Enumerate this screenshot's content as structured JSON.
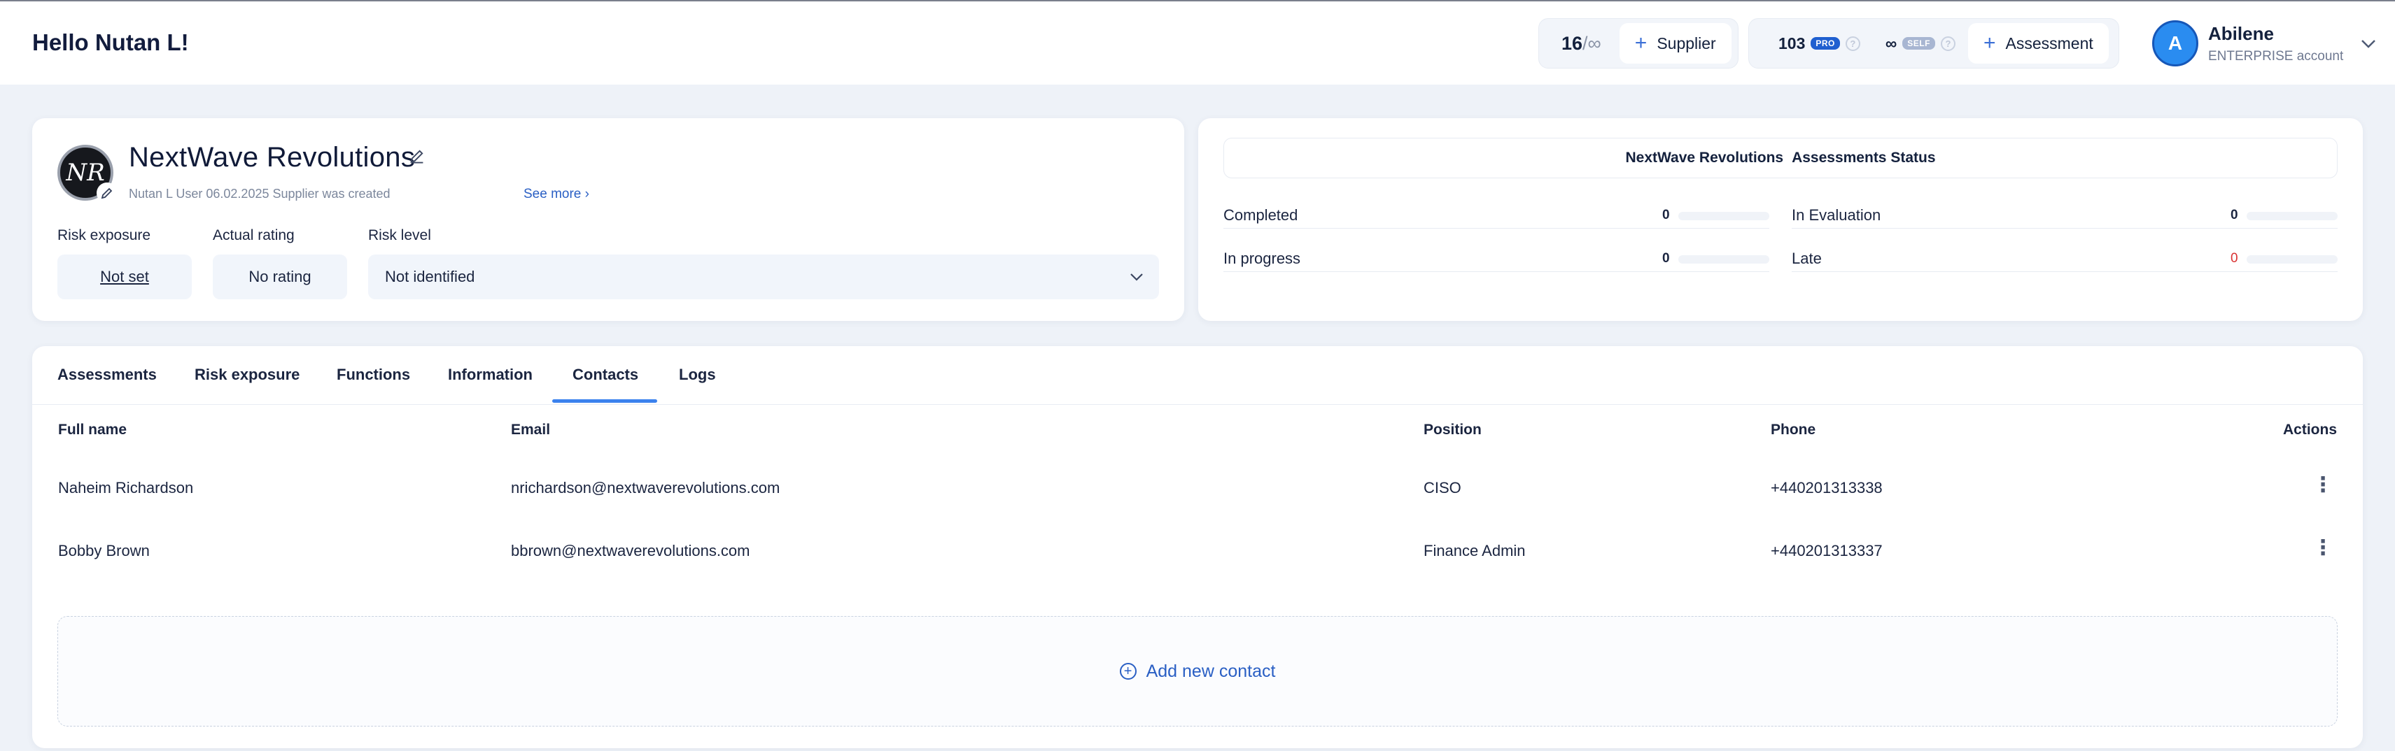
{
  "header": {
    "greeting": "Hello Nutan L!",
    "supplier_count": "16",
    "supplier_limit": "/∞",
    "supplier_button": "Supplier",
    "pro_count": "103",
    "pro_badge": "PRO",
    "self_count": "∞",
    "self_badge": "SELF",
    "assessment_button": "Assessment",
    "help_glyph": "?"
  },
  "user": {
    "initial": "A",
    "name": "Abilene",
    "plan": "ENTERPRISE account"
  },
  "company": {
    "logo_text": "NR",
    "name": "NextWave Revolutions",
    "created_note": "Nutan L User 06.02.2025 Supplier was created",
    "see_more": "See more ›",
    "fields": {
      "risk_exposure_label": "Risk exposure",
      "risk_exposure_value": "Not set",
      "actual_rating_label": "Actual rating",
      "actual_rating_value": "No rating",
      "risk_level_label": "Risk level",
      "risk_level_value": "Not identified"
    }
  },
  "status": {
    "company": "NextWave Revolutions",
    "title": "Assessments Status",
    "items": [
      {
        "label": "Completed",
        "value": "0",
        "fraction": 0
      },
      {
        "label": "In Evaluation",
        "value": "0",
        "fraction": 0
      },
      {
        "label": "In progress",
        "value": "0",
        "fraction": 0
      },
      {
        "label": "Late",
        "value": "0",
        "fraction": 0
      }
    ]
  },
  "tabs": [
    {
      "label": "Assessments"
    },
    {
      "label": "Risk exposure"
    },
    {
      "label": "Functions"
    },
    {
      "label": "Information"
    },
    {
      "label": "Contacts",
      "active": true
    },
    {
      "label": "Logs"
    }
  ],
  "contacts": {
    "columns": [
      "Full name",
      "Email",
      "Position",
      "Phone",
      "Actions"
    ],
    "rows": [
      {
        "name": "Naheim Richardson",
        "email": "nrichardson@nextwaverevolutions.com",
        "position": "CISO",
        "phone": "+440201313338"
      },
      {
        "name": "Bobby Brown",
        "email": "bbrown@nextwaverevolutions.com",
        "position": "Finance Admin",
        "phone": "+440201313337"
      }
    ],
    "add_label": "Add new contact"
  },
  "colors": {
    "accent": "#3b82ee",
    "link": "#2a5fc4",
    "late": "#d93232",
    "avatar": "#2a8cf0"
  }
}
